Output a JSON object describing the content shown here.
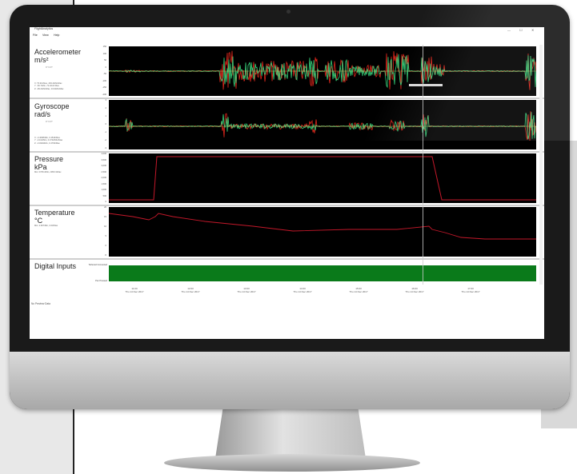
{
  "window": {
    "title": "FlightAnalytics",
    "controls": [
      "—",
      "☐",
      "✕"
    ]
  },
  "menu": [
    "File",
    "View",
    "Help"
  ],
  "panels": [
    {
      "title": "Accelerometer",
      "unit": "m/s²",
      "axis_buttons": "X Y Z T",
      "stats": [
        "X: 79.9/1/Max, 293.4/Min/Max",
        "Y: -50.7/Min, 72.2/116 Max",
        "Z: -99.2/Min/Max, 34.9/Min/Max"
      ],
      "yticks": [
        "150",
        "100",
        "50",
        "0",
        "-50",
        "-100",
        "-150",
        "-200"
      ],
      "trace_colors": [
        "#e0271c",
        "#38d27a"
      ]
    },
    {
      "title": "Gyroscope",
      "unit": "rad/s",
      "axis_buttons": "X Y Z T",
      "stats": [
        "X: -0.4098/Min, 0.4543/Max",
        "Y: -0.162/Min, 0.3720/Min/Max",
        "Z: -0.4994/Min, 0.4793/Max"
      ],
      "yticks": [
        "3",
        "2",
        "1",
        "0",
        "-1",
        "-2",
        "-3"
      ],
      "trace_colors": [
        "#e0271c",
        "#38d27a"
      ]
    },
    {
      "title": "Pressure",
      "unit": "kPa",
      "stats": [
        "Min: 0708.4/Min, 3803.3/Max"
      ],
      "yticks": [
        "4,000",
        "3,500",
        "3,000",
        "2,500",
        "2,000",
        "1,500",
        "1,000",
        "500",
        "0"
      ],
      "trace_colors": [
        "#c4182a"
      ]
    },
    {
      "title": "Temperature",
      "unit": "°C",
      "stats": [
        "Min: 4.997/Min, 0.00/Max"
      ],
      "yticks": [
        "20",
        "15",
        "10",
        "5",
        "0",
        "-5"
      ],
      "trace_colors": [
        "#c4182a"
      ]
    },
    {
      "title": "Digital Inputs",
      "unit": "",
      "stats": [],
      "rows": [
        "Tethered Connected",
        "Pen Pressed"
      ],
      "fill_color": "#0a7a1a"
    }
  ],
  "x_axis": [
    {
      "time": "11:00",
      "date": "Thu 14 Dec 2017"
    },
    {
      "time": "12:00",
      "date": "Thu 14 Dec 2017"
    },
    {
      "time": "13:00",
      "date": "Thu 14 Dec 2017"
    },
    {
      "time": "14:00",
      "date": "Thu 14 Dec 2017"
    },
    {
      "time": "15:00",
      "date": "Thu 14 Dec 2017"
    },
    {
      "time": "16:00",
      "date": "Thu 14 Dec 2017"
    },
    {
      "time": "17:00",
      "date": "Thu 14 Dec 2017"
    }
  ],
  "status": "No Preview Data"
}
